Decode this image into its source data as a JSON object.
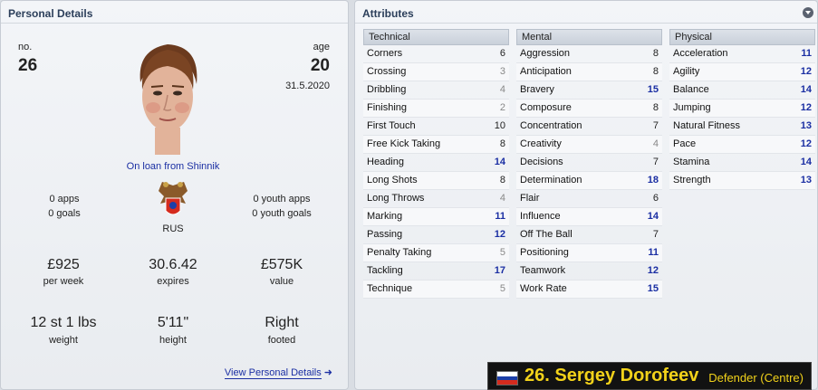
{
  "personal": {
    "title": "Personal Details",
    "no_label": "no.",
    "no_value": "26",
    "age_label": "age",
    "age_value": "20",
    "birth_date": "31.5.2020",
    "loan_text": "On loan from Shinnik",
    "apps": "0 apps",
    "goals": "0 goals",
    "youth_apps": "0 youth apps",
    "youth_goals": "0 youth goals",
    "nation_code": "RUS",
    "wage_value": "£925",
    "wage_label": "per week",
    "expires_value": "30.6.42",
    "expires_label": "expires",
    "value_value": "£575K",
    "value_label": "value",
    "weight_value": "12 st 1 lbs",
    "weight_label": "weight",
    "height_value": "5'11\"",
    "height_label": "height",
    "foot_value": "Right",
    "foot_label": "footed",
    "view_link": "View Personal Details"
  },
  "attributes": {
    "title": "Attributes",
    "technical": {
      "header": "Technical",
      "items": [
        {
          "name": "Corners",
          "value": "6"
        },
        {
          "name": "Crossing",
          "value": "3"
        },
        {
          "name": "Dribbling",
          "value": "4"
        },
        {
          "name": "Finishing",
          "value": "2"
        },
        {
          "name": "First Touch",
          "value": "10"
        },
        {
          "name": "Free Kick Taking",
          "value": "8"
        },
        {
          "name": "Heading",
          "value": "14"
        },
        {
          "name": "Long Shots",
          "value": "8"
        },
        {
          "name": "Long Throws",
          "value": "4"
        },
        {
          "name": "Marking",
          "value": "11"
        },
        {
          "name": "Passing",
          "value": "12"
        },
        {
          "name": "Penalty Taking",
          "value": "5"
        },
        {
          "name": "Tackling",
          "value": "17"
        },
        {
          "name": "Technique",
          "value": "5"
        }
      ]
    },
    "mental": {
      "header": "Mental",
      "items": [
        {
          "name": "Aggression",
          "value": "8"
        },
        {
          "name": "Anticipation",
          "value": "8"
        },
        {
          "name": "Bravery",
          "value": "15"
        },
        {
          "name": "Composure",
          "value": "8"
        },
        {
          "name": "Concentration",
          "value": "7"
        },
        {
          "name": "Creativity",
          "value": "4"
        },
        {
          "name": "Decisions",
          "value": "7"
        },
        {
          "name": "Determination",
          "value": "18"
        },
        {
          "name": "Flair",
          "value": "6"
        },
        {
          "name": "Influence",
          "value": "14"
        },
        {
          "name": "Off The Ball",
          "value": "7"
        },
        {
          "name": "Positioning",
          "value": "11"
        },
        {
          "name": "Teamwork",
          "value": "12"
        },
        {
          "name": "Work Rate",
          "value": "15"
        }
      ]
    },
    "physical": {
      "header": "Physical",
      "items": [
        {
          "name": "Acceleration",
          "value": "11"
        },
        {
          "name": "Agility",
          "value": "12"
        },
        {
          "name": "Balance",
          "value": "14"
        },
        {
          "name": "Jumping",
          "value": "12"
        },
        {
          "name": "Natural Fitness",
          "value": "13"
        },
        {
          "name": "Pace",
          "value": "12"
        },
        {
          "name": "Stamina",
          "value": "14"
        },
        {
          "name": "Strength",
          "value": "13"
        }
      ]
    }
  },
  "player": {
    "number_name": "26. Sergey Dorofeev",
    "position": "Defender (Centre)"
  },
  "colors": {
    "link": "#1b2fa3",
    "name_bar_bg": "#121212",
    "name_text": "#f2d21a",
    "flag": [
      "#ffffff",
      "#1c3fa8",
      "#d52b1e"
    ]
  }
}
